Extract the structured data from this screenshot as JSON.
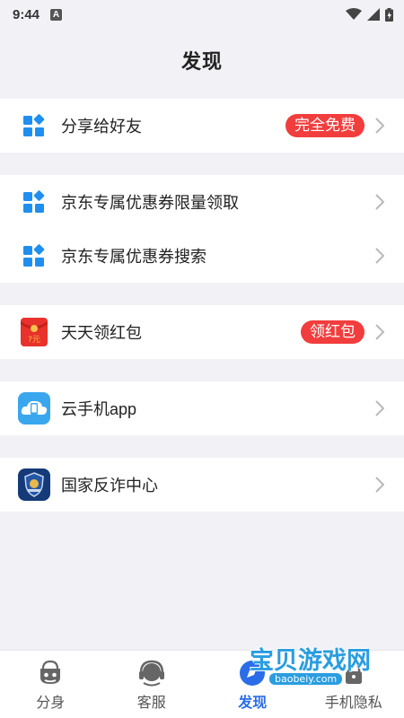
{
  "status_bar": {
    "time": "9:44",
    "notification_letter": "A"
  },
  "header": {
    "title": "发现"
  },
  "sections": [
    [
      {
        "label": "分享给好友",
        "badge": "完全免费",
        "icon": "grid-diamond-icon"
      }
    ],
    [
      {
        "label": "京东专属优惠券限量领取",
        "icon": "grid-diamond-icon"
      },
      {
        "label": "京东专属优惠券搜索",
        "icon": "grid-diamond-icon"
      }
    ],
    [
      {
        "label": "天天领红包",
        "badge": "领红包",
        "icon": "red-envelope-icon",
        "icon_text": "?元"
      }
    ],
    [
      {
        "label": "云手机app",
        "icon": "cloud-phone-icon"
      }
    ],
    [
      {
        "label": "国家反诈中心",
        "icon": "police-shield-icon"
      }
    ]
  ],
  "tabbar": {
    "tabs": [
      {
        "label": "分身",
        "icon": "clone-face-icon",
        "active": false
      },
      {
        "label": "客服",
        "icon": "headset-icon",
        "active": false
      },
      {
        "label": "发现",
        "icon": "compass-icon",
        "active": true
      },
      {
        "label": "手机隐私",
        "icon": "lock-icon",
        "active": false
      }
    ]
  },
  "watermark": {
    "text": "宝贝游戏网",
    "url": "baobeiy.com"
  },
  "colors": {
    "accent": "#2b6de8",
    "badge": "#f23d3d",
    "icon_blue": "#1e8ff0",
    "background": "#f2f2f6"
  }
}
